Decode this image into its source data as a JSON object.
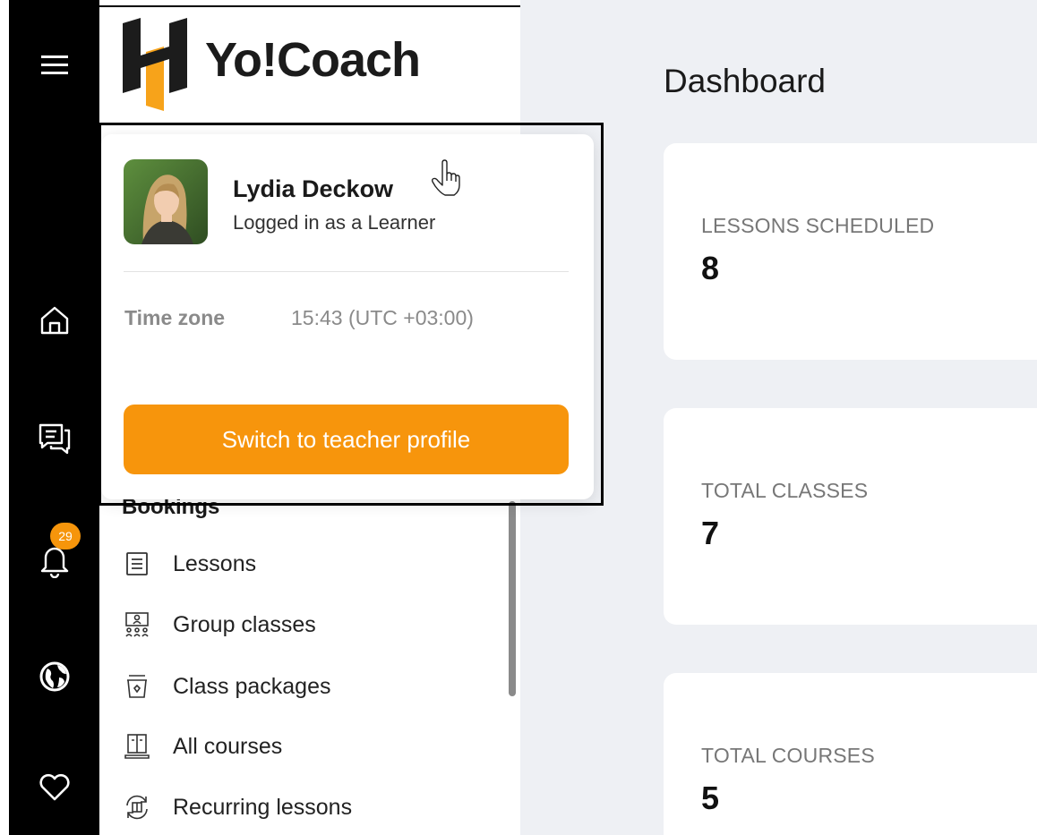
{
  "brand": {
    "name": "Yo!Coach",
    "accent": "#f7950c"
  },
  "rail": {
    "menu_icon": "hamburger-icon",
    "items": [
      {
        "icon": "home-icon"
      },
      {
        "icon": "chat-icon"
      },
      {
        "icon": "bell-icon",
        "badge": "29"
      },
      {
        "icon": "globe-icon"
      },
      {
        "icon": "heart-icon"
      }
    ]
  },
  "profile_popup": {
    "name": "Lydia Deckow",
    "role": "Logged in as a Learner",
    "timezone_label": "Time zone",
    "timezone_value": "15:43 (UTC +03:00)",
    "switch_button": "Switch to teacher profile"
  },
  "sidebar": {
    "section_title": "Bookings",
    "items": [
      {
        "label": "Lessons",
        "icon": "list-icon"
      },
      {
        "label": "Group classes",
        "icon": "group-icon"
      },
      {
        "label": "Class packages",
        "icon": "package-icon"
      },
      {
        "label": "All courses",
        "icon": "book-icon"
      },
      {
        "label": "Recurring lessons",
        "icon": "recurring-icon"
      }
    ]
  },
  "main": {
    "page_title": "Dashboard",
    "cards": [
      {
        "label": "LESSONS SCHEDULED",
        "value": "8"
      },
      {
        "label": "TOTAL CLASSES",
        "value": "7"
      },
      {
        "label": "TOTAL COURSES",
        "value": "5"
      }
    ]
  }
}
